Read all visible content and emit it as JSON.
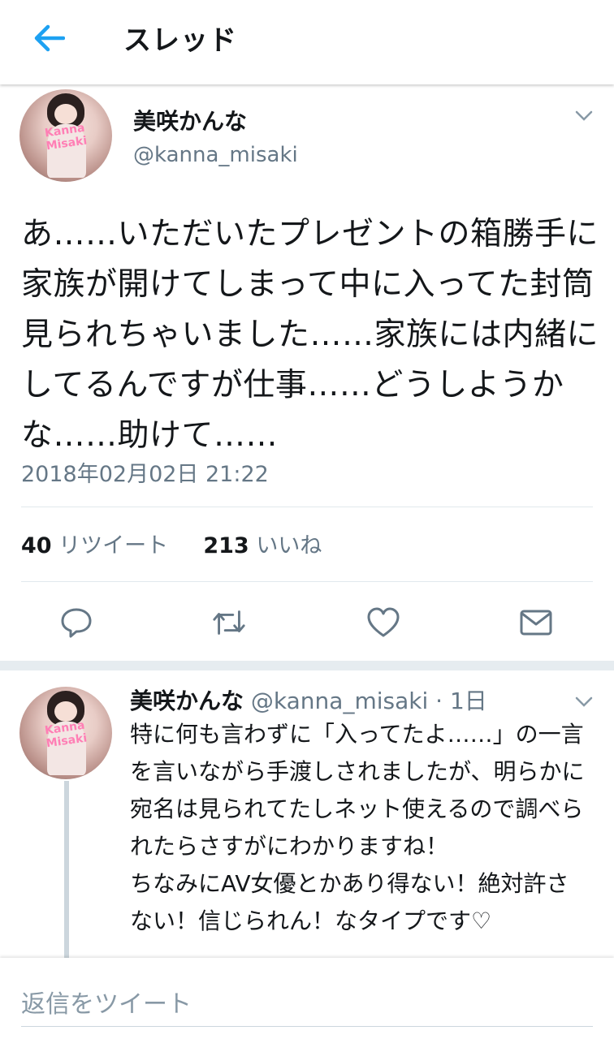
{
  "header": {
    "title": "スレッド",
    "back_icon": "arrow-left-icon"
  },
  "colors": {
    "accent": "#1da1f2",
    "secondary_text": "#657786",
    "divider": "#e1e8ed"
  },
  "main_tweet": {
    "author_name": "美咲かんな",
    "handle": "@kanna_misaki",
    "avatar_watermark": "Kanna Misaki",
    "text": "あ……いただいたプレゼントの箱勝手に家族が開けてしまって中に入ってた封筒見られちゃいました……家族には内緒にしてるんですが仕事……どうしようかな……助けて……",
    "timestamp": "2018年02月02日 21:22",
    "retweet_count": "40",
    "retweet_label": "リツイート",
    "like_count": "213",
    "like_label": "いいね",
    "actions": [
      "reply-icon",
      "retweet-icon",
      "like-icon",
      "message-icon"
    ]
  },
  "reply_tweet": {
    "author_name": "美咲かんな",
    "handle": "@kanna_misaki",
    "time": "· 1日",
    "avatar_watermark": "Kanna Misaki",
    "text": "特に何も言わずに「入ってたよ……」の一言を言いながら手渡しされましたが、明らかに宛名は見られてたしネット使えるので調べられたらさすがにわかりますね！\nちなみにAV女優とかあり得ない！絶対許さない！信じられん！なタイプです♡"
  },
  "compose": {
    "placeholder": "返信をツイート"
  }
}
